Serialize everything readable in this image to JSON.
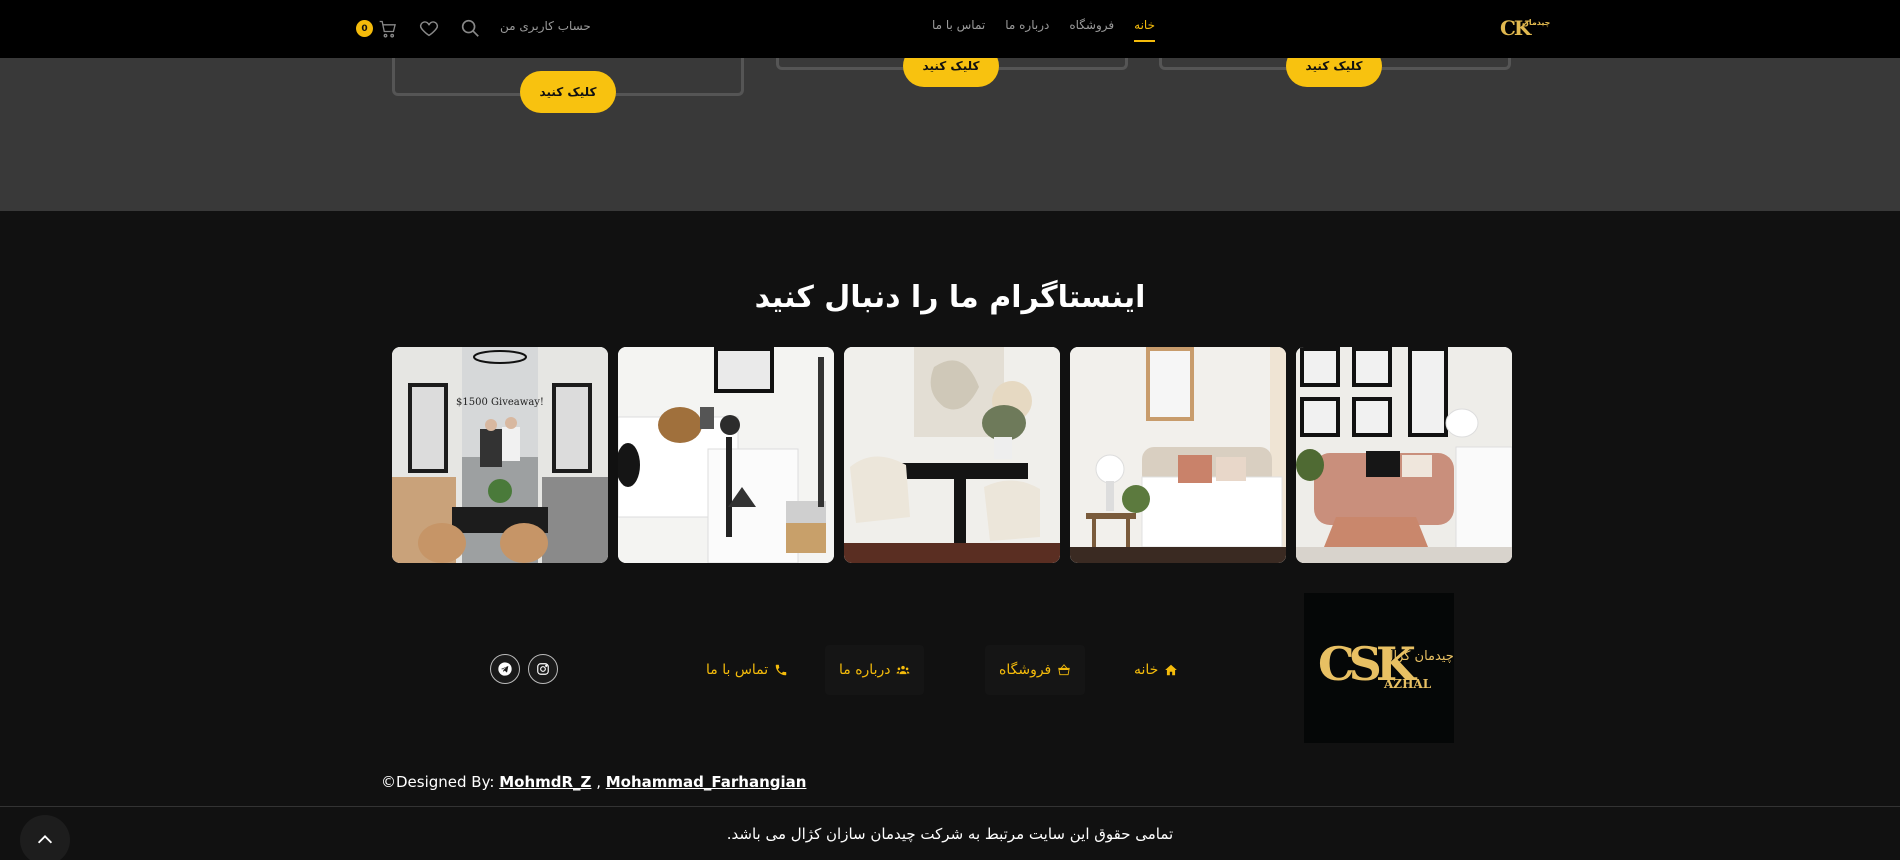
{
  "header": {
    "logo_text": "CK",
    "logo_sub": "چیدمان",
    "nav": [
      "خانه",
      "فروشگاه",
      "درباره ما",
      "تماس با ما"
    ],
    "account_label": "حساب کاربری من",
    "cart_count": "0"
  },
  "products": {
    "button_label": "کلیک کنید"
  },
  "instagram": {
    "title": "اینستاگرام ما را دنبال کنید",
    "photos": [
      {
        "icon": "living-room-pink-sofa"
      },
      {
        "icon": "bedroom-white-bed"
      },
      {
        "icon": "dining-room"
      },
      {
        "icon": "shelf-decor"
      },
      {
        "icon": "giveaway-couple"
      }
    ],
    "giveaway_text": "$1500 Giveaway!"
  },
  "footer": {
    "logo_big": "CSK",
    "logo_word": "AZHAL",
    "logo_fa": "چیدمان کژال",
    "nav": {
      "home": "خانه",
      "shop": "فروشگاه",
      "about": "درباره ما",
      "contact": "تماس با ما"
    },
    "designed_by_prefix": "©Designed By: ",
    "designer_1": "MohmdR_Z",
    "separator": " , ",
    "designer_2": "Mohammad_Farhangian",
    "copyright": "تمامی حقوق این سایت مرتبط به شرکت چیدمان سازان کژال می باشد."
  },
  "colors": {
    "accent": "#f4bb0b",
    "header_bg": "#000000",
    "strip_bg": "#393939",
    "body_bg": "#111111"
  }
}
